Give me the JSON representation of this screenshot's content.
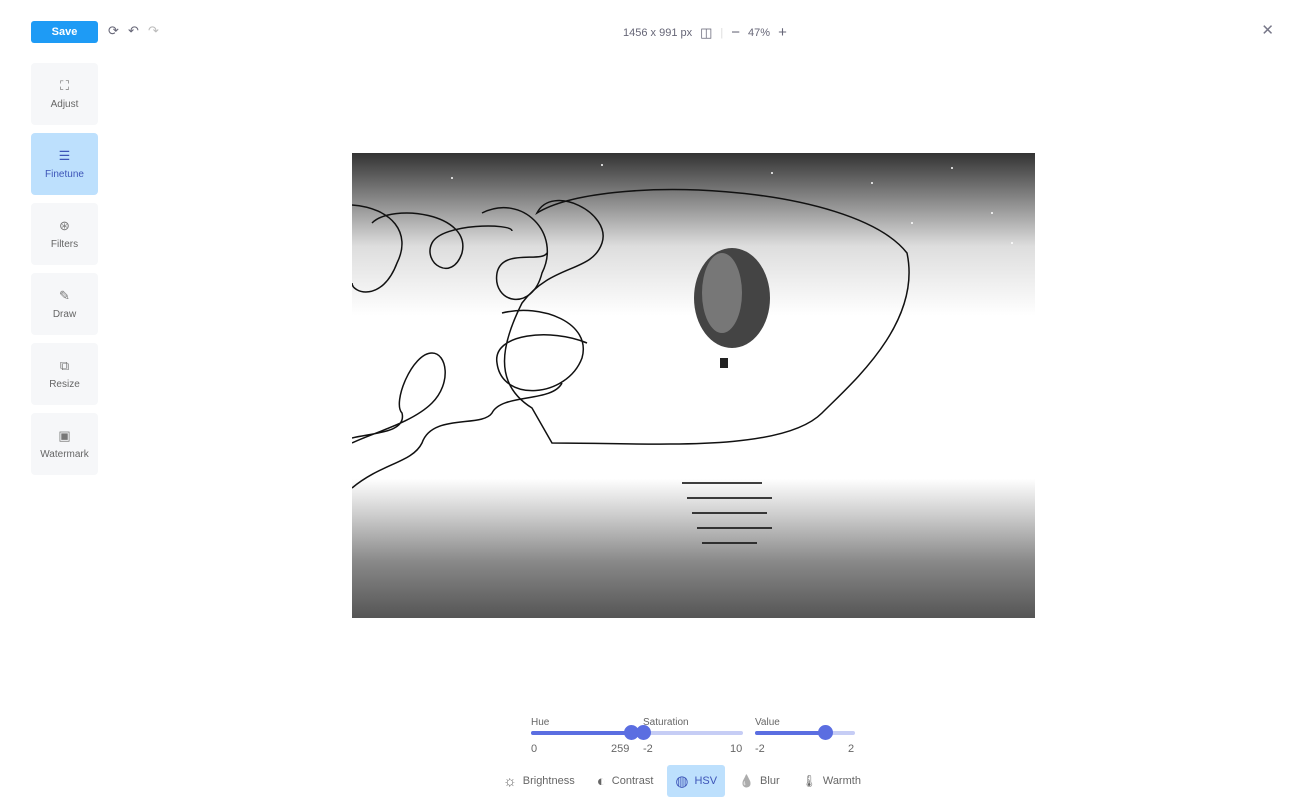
{
  "toolbar": {
    "save_label": "Save",
    "icons": [
      "reset-icon",
      "undo-icon",
      "redo-icon"
    ],
    "dimensions": "1456 x 991 px",
    "zoom": "47%"
  },
  "sidebar": {
    "items": [
      {
        "label": "Adjust",
        "icon": "⛶"
      },
      {
        "label": "Finetune",
        "icon": "☰",
        "active": true
      },
      {
        "label": "Filters",
        "icon": "⊛"
      },
      {
        "label": "Draw",
        "icon": "✎"
      },
      {
        "label": "Resize",
        "icon": "⧉"
      },
      {
        "label": "Watermark",
        "icon": "▣"
      }
    ]
  },
  "hsv": {
    "hue": {
      "label": "Hue",
      "min": "0",
      "max": "259",
      "level": 0.89
    },
    "saturation": {
      "label": "Saturation",
      "min": "-2",
      "max": "10",
      "level": 0.0
    },
    "value": {
      "label": "Value",
      "min": "-2",
      "max": "2",
      "level": 0.63
    }
  },
  "tabs": [
    {
      "label": "Brightness",
      "icon": "☼"
    },
    {
      "label": "Contrast",
      "icon": "◐"
    },
    {
      "label": "HSV",
      "icon": "◍",
      "active": true
    },
    {
      "label": "Blur",
      "icon": "💧"
    },
    {
      "label": "Warmth",
      "icon": "🌡"
    }
  ],
  "colors": {
    "accent": "#1e9bf5",
    "active_bg": "#bde0fd",
    "slider": "#5b6ee1"
  }
}
